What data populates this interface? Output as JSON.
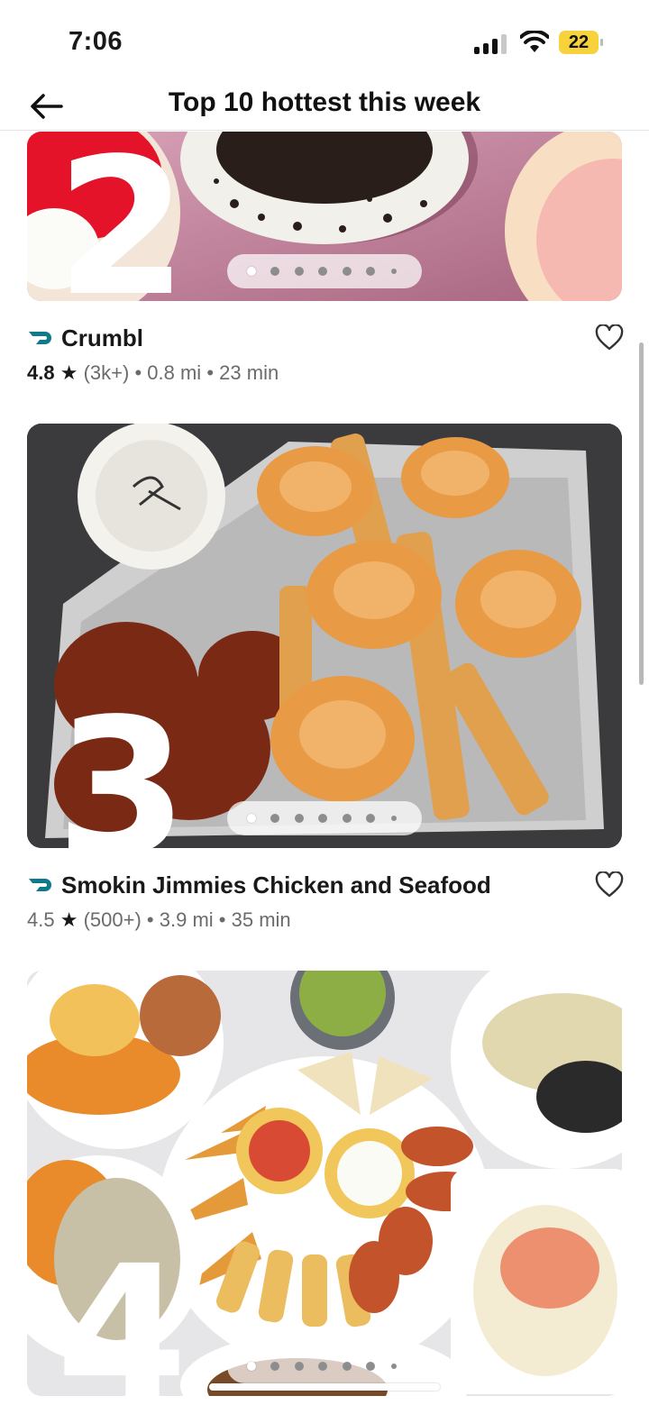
{
  "status_bar": {
    "time": "7:06",
    "battery": "22"
  },
  "header": {
    "title": "Top 10 hottest this week",
    "back_icon": "arrow-left-icon"
  },
  "stores": [
    {
      "rank": "2",
      "name": "Crumbl",
      "rating": "4.8",
      "reviews": "(3k+)",
      "distance": "0.8 mi",
      "time": "23 min",
      "dashpass": true,
      "image_theme": "pink cookie platter",
      "image_index": 0
    },
    {
      "rank": "3",
      "name": "Smokin Jimmies Chicken and Seafood",
      "rating": "4.5",
      "reviews": "(500+)",
      "distance": "3.9 mi",
      "time": "35 min",
      "dashpass": true,
      "image_theme": "fried shrimp and wings",
      "image_index": 0
    },
    {
      "rank": "4",
      "image_theme": "mexican food spread",
      "image_index": 0
    }
  ],
  "separator": "•",
  "colors": {
    "dashpass": "#0f7b8a",
    "accent": "#111111"
  }
}
